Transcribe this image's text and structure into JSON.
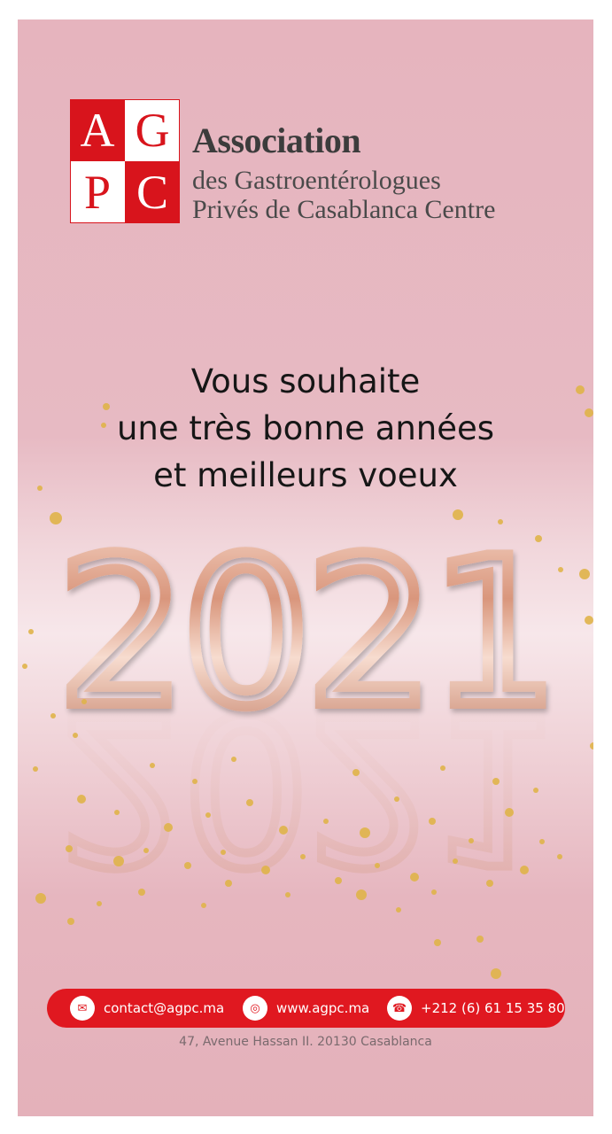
{
  "logo": {
    "letters": [
      "A",
      "G",
      "P",
      "C"
    ],
    "title": "Association",
    "line1": "des Gastroentérologues",
    "line2": "Privés de Casablanca Centre",
    "colors": {
      "red": "#d8141c",
      "white": "#ffffff"
    }
  },
  "greeting": {
    "line1": "Vous souhaite",
    "line2": "une très bonne années",
    "line3": "et meilleurs voeux"
  },
  "year": "2021",
  "contact": {
    "email": "contact@agpc.ma",
    "website": "www.agpc.ma",
    "phone": "+212 (6) 61 15 35 80",
    "icons": [
      "envelope-icon",
      "globe-icon",
      "phone-icon"
    ],
    "bar_color": "#e01820"
  },
  "address": "47, Avenue Hassan II. 20130  Casablanca"
}
